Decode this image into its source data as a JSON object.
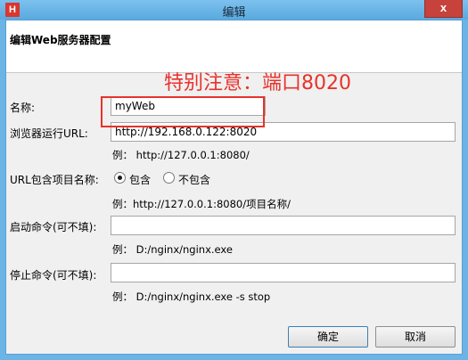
{
  "window": {
    "app_icon": "H",
    "title": "编辑",
    "close_glyph": "x"
  },
  "banner": {
    "title": "编辑Web服务器配置"
  },
  "annotation": {
    "text": "特别注意：端口8020",
    "color": "#e8322b"
  },
  "form": {
    "name_label": "名称:",
    "name_value": "myWeb",
    "url_label": "浏览器运行URL:",
    "url_value": "http://192.168.0.122:8020",
    "url_hint": "例： http://127.0.0.1:8080/",
    "include_label": "URL包含项目名称:",
    "include_option": "包含",
    "exclude_option": "不包含",
    "include_selected": "包含",
    "include_hint": "例：http://127.0.0.1:8080/项目名称/",
    "start_label": "启动命令(可不填):",
    "start_value": "",
    "start_hint": "例： D:/nginx/nginx.exe",
    "stop_label": "停止命令(可不填):",
    "stop_value": "",
    "stop_hint": "例： D:/nginx/nginx.exe -s stop"
  },
  "buttons": {
    "ok": "确定",
    "cancel": "取消"
  },
  "colors": {
    "titlebar": "#6db4e6",
    "close": "#c7423b",
    "annotation": "#e8322b"
  }
}
